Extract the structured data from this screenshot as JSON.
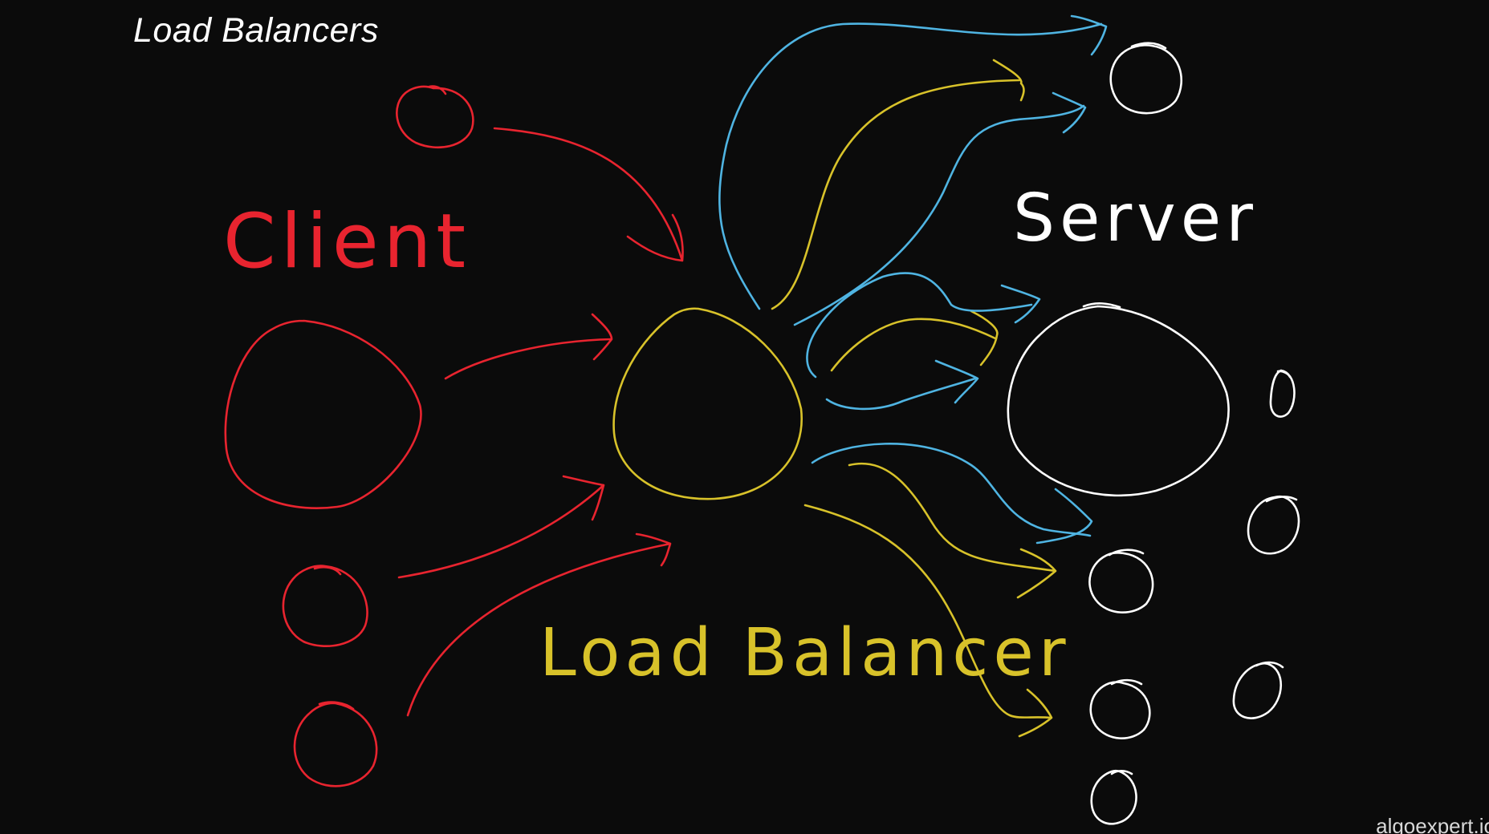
{
  "title": "Load Balancers",
  "watermark": "algoexpert.io",
  "colors": {
    "background": "#0b0b0b",
    "client": "#e8242f",
    "load_balancer": "#d8c22a",
    "server": "#ffffff",
    "request_paths": "#4fb4e2",
    "title": "#ffffff"
  },
  "labels": {
    "client": "Client",
    "load_balancer": "Load Balancer",
    "server": "Server"
  },
  "nodes": {
    "clients": [
      "client-1",
      "client-2",
      "client-3",
      "client-4"
    ],
    "load_balancer": "load-balancer",
    "servers": [
      "server-1",
      "server-2",
      "server-3",
      "server-4",
      "server-5",
      "server-6",
      "server-7",
      "server-8"
    ]
  }
}
